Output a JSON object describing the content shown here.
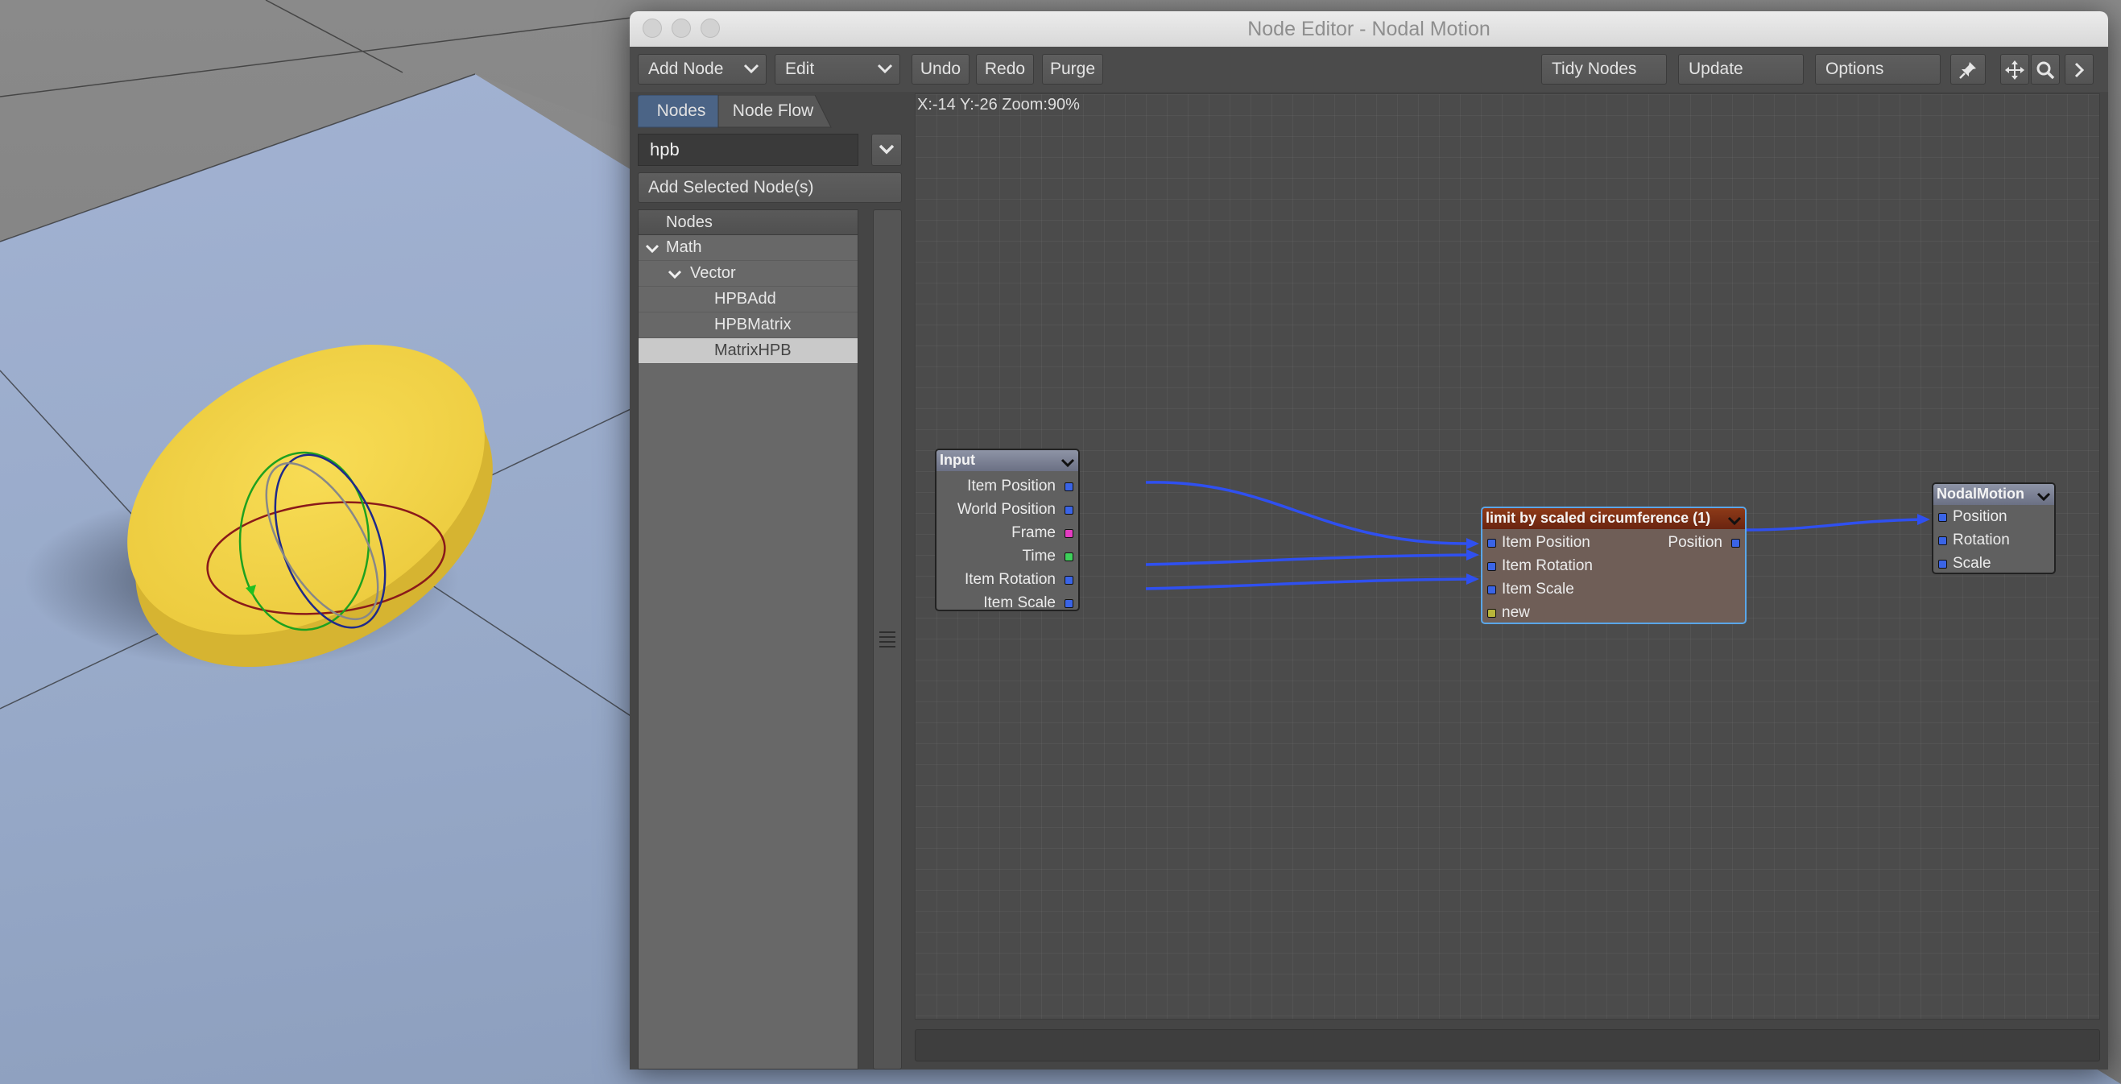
{
  "window": {
    "title": "Node Editor - Nodal Motion"
  },
  "toolbar": {
    "add_node": "Add Node",
    "edit": "Edit",
    "undo": "Undo",
    "redo": "Redo",
    "purge": "Purge",
    "tidy_nodes": "Tidy Nodes",
    "update": "Update",
    "options": "Options",
    "icons": [
      "pin-icon",
      "move-icon",
      "zoom-icon",
      "expand-arrow-icon"
    ]
  },
  "sidebar": {
    "tabs": [
      {
        "label": "Nodes",
        "active": true
      },
      {
        "label": "Node Flow",
        "active": false
      }
    ],
    "search_value": "hpb",
    "add_selected": "Add Selected Node(s)",
    "tree_header": "Nodes",
    "tree": [
      {
        "label": "Math",
        "level": 0,
        "expanded": true
      },
      {
        "label": "Vector",
        "level": 1,
        "expanded": true
      },
      {
        "label": "HPBAdd",
        "level": 2
      },
      {
        "label": "HPBMatrix",
        "level": 2
      },
      {
        "label": "MatrixHPB",
        "level": 2,
        "selected": true
      }
    ]
  },
  "canvas": {
    "coord_readout": "X:-14 Y:-26 Zoom:90%",
    "wire_color": "#2f50f0",
    "nodes": {
      "input": {
        "title": "Input",
        "outputs": [
          {
            "label": "Item Position",
            "color": "#3a64e6"
          },
          {
            "label": "World Position",
            "color": "#3a64e6"
          },
          {
            "label": "Frame",
            "color": "#e43cc2"
          },
          {
            "label": "Time",
            "color": "#3ed05a"
          },
          {
            "label": "Item Rotation",
            "color": "#3a64e6"
          },
          {
            "label": "Item Scale",
            "color": "#3a64e6"
          }
        ]
      },
      "limit": {
        "title": "limit by scaled circumference (1)",
        "header_color": "#7a2a10",
        "inputs": [
          {
            "label": "Item Position",
            "color": "#3a64e6"
          },
          {
            "label": "Item Rotation",
            "color": "#3a64e6"
          },
          {
            "label": "Item Scale",
            "color": "#3a64e6"
          },
          {
            "label": "new",
            "color": "#b9b53a"
          }
        ],
        "outputs": [
          {
            "label": "Position",
            "color": "#3a64e6"
          }
        ]
      },
      "nodal_motion": {
        "title": "NodalMotion",
        "inputs": [
          {
            "label": "Position",
            "color": "#3a64e6"
          },
          {
            "label": "Rotation",
            "color": "#3a64e6"
          },
          {
            "label": "Scale",
            "color": "#3a64e6"
          }
        ]
      }
    }
  }
}
